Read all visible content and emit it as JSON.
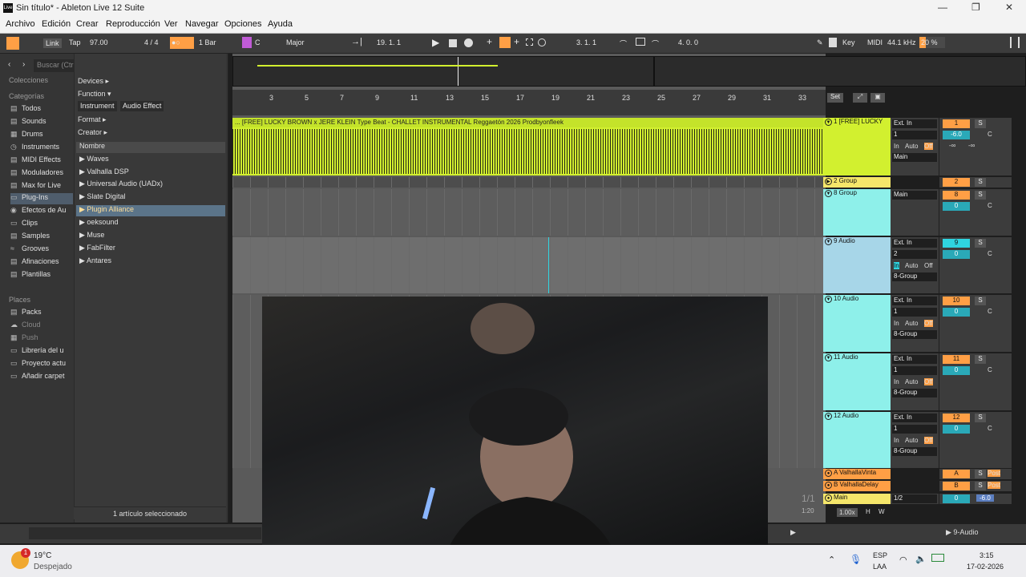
{
  "window": {
    "title": "Sin título* - Ableton Live 12 Suite",
    "app_icon": "Live",
    "min": "—",
    "max": "❐",
    "close": "✕"
  },
  "menu": [
    "Archivo",
    "Edición",
    "Crear",
    "Reproducción",
    "Ver",
    "Navegar",
    "Opciones",
    "Ayuda"
  ],
  "transport": {
    "link": "Link",
    "tap": "Tap",
    "tempo": "97.00",
    "signature": "4 / 4",
    "quantize": "1 Bar",
    "key": "C",
    "scale": "Major",
    "position": "19.  1.  1",
    "loop_start": "3.  1.  1",
    "loop_length": "4.  0.  0",
    "key_map": "Key",
    "midi": "MIDI",
    "sample_rate": "44.1 kHz",
    "cpu": "20 %"
  },
  "browser": {
    "search_placeholder": "Buscar (Ctrl + F)",
    "collections_title": "Colecciones",
    "categories_title": "Categorías",
    "categories": [
      "Todos",
      "Sounds",
      "Drums",
      "Instruments",
      "MIDI Effects",
      "Moduladores",
      "Max for Live",
      "Plug-Ins",
      "Clips",
      "Samples",
      "Grooves",
      "Afinaciones",
      "Plantillas"
    ],
    "places_title": "Places",
    "places": [
      "Packs",
      "Cloud",
      "Push",
      "Librería del u",
      "Proyecto actu",
      "Añadir carpet"
    ],
    "filters": [
      "Devices ▸",
      "Function ▾",
      "Format ▸",
      "Creator ▸"
    ],
    "tags": [
      "Instrument",
      "Audio Effect"
    ],
    "column_header": "Nombre",
    "plugins": [
      "Waves",
      "Valhalla DSP",
      "Universal Audio (UADx)",
      "Slate Digital",
      "Plugin Alliance",
      "oeksound",
      "Muse",
      "FabFilter",
      "Antares"
    ],
    "status": "1 artículo seleccionado"
  },
  "ruler": [
    "3",
    "5",
    "7",
    "9",
    "11",
    "13",
    "15",
    "17",
    "19",
    "21",
    "23",
    "25",
    "27",
    "29",
    "31",
    "33"
  ],
  "set_label": "Set",
  "clip_name": "... [FREE] LUCKY BROWN x JERE KLEIN Type Beat - CHALLET INSTRUMENTAL Reggaetón 2026 Prodbyonfleek",
  "tracks": [
    {
      "name": "1 [FREE] LUCKY",
      "input": "Ext. In",
      "chan": "1",
      "out": "Main",
      "num": "1",
      "vol": "-6.0",
      "pan": "C",
      "color": "#d2f02f"
    },
    {
      "name": "2 Group",
      "num": "2",
      "color": "#f5e66a"
    },
    {
      "name": "8 Group",
      "out": "Main",
      "num": "8",
      "vol": "0",
      "pan": "C",
      "color": "#8ef0ea"
    },
    {
      "name": "9 Audio",
      "input": "Ext. In",
      "chan": "2",
      "out": "8-Group",
      "num": "9",
      "vol": "0",
      "pan": "C",
      "color": "#a7d6e8"
    },
    {
      "name": "10 Audio",
      "input": "Ext. In",
      "chan": "1",
      "out": "8-Group",
      "num": "10",
      "vol": "0",
      "pan": "C",
      "color": "#8ef0ea"
    },
    {
      "name": "11 Audio",
      "input": "Ext. In",
      "chan": "1",
      "out": "8-Group",
      "num": "11",
      "vol": "0",
      "pan": "C",
      "color": "#8ef0ea"
    },
    {
      "name": "12 Audio",
      "input": "Ext. In",
      "chan": "1",
      "out": "8-Group",
      "num": "12",
      "vol": "0",
      "pan": "C",
      "color": "#8ef0ea"
    }
  ],
  "returns": [
    {
      "name": "A ValhallaVinta",
      "letter": "A",
      "post": "Post"
    },
    {
      "name": "B ValhallaDelay",
      "letter": "B",
      "post": "Post"
    }
  ],
  "main": {
    "name": "Main",
    "ratio": "1/2",
    "vol": "0",
    "pan": "-6.0",
    "page": "1/1",
    "zoom": "1.00x",
    "time": "1:20"
  },
  "labels": {
    "in": "In",
    "auto": "Auto",
    "off": "Off",
    "s": "S",
    "c": "C",
    "neg_inf": "-∞",
    "h": "H",
    "w": "W",
    "bottom_track": "9-Audio"
  },
  "taskbar": {
    "temp": "19°C",
    "weather": "Despejado",
    "lang1": "ESP",
    "lang2": "LAA",
    "time": "3:15",
    "date": "17-02-2026",
    "badge": "1"
  }
}
